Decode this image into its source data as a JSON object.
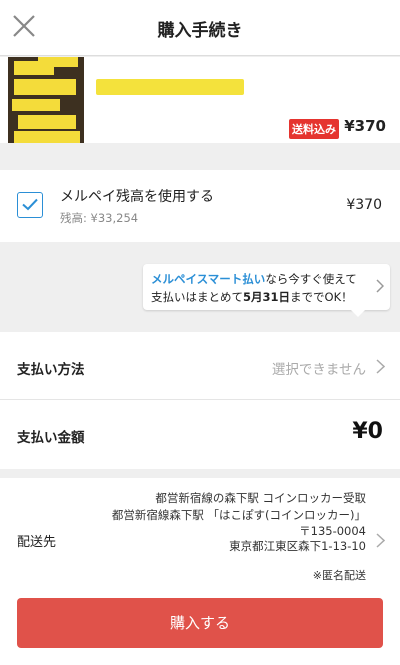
{
  "header": {
    "title": "購入手続き"
  },
  "item": {
    "shipping_badge": "送料込み",
    "price": "¥370"
  },
  "points": {
    "label": "メルペイ残高を使用する",
    "balance": "残高: ¥33,254",
    "amount": "¥370",
    "checked": true
  },
  "promo": {
    "link_text": "メルペイスマート払い",
    "line1_rest": "なら今すぐ使えて",
    "line2_prefix": "支払いはまとめて",
    "line2_bold": "5月31日",
    "line2_suffix": "まででOK！"
  },
  "payment": {
    "method_label": "支払い方法",
    "method_value": "選択できません",
    "amount_label": "支払い金額",
    "amount_value": "¥0"
  },
  "shipping": {
    "label": "配送先",
    "lines": [
      "都営新宿線の森下駅 コインロッカー受取",
      "都営新宿線森下駅 「はこぽす(コインロッカー)」",
      "〒135-0004",
      "東京都江東区森下1-13-10"
    ],
    "note": "※匿名配送"
  },
  "actions": {
    "purchase_label": "購入する"
  },
  "colors": {
    "accent_blue": "#2b8fd6",
    "badge_red": "#e5342f",
    "button_red": "#e0524a"
  }
}
